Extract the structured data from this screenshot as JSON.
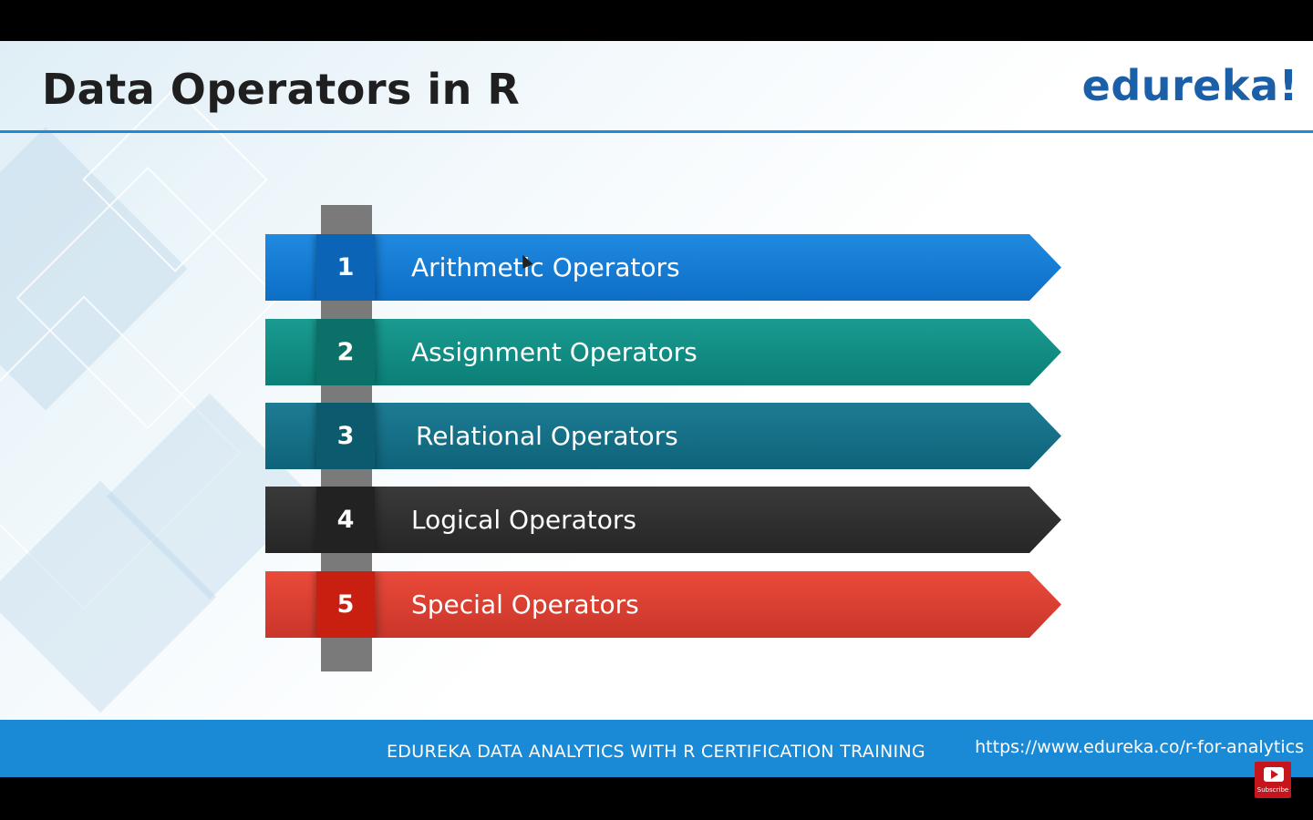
{
  "slide": {
    "title": "Data Operators in R",
    "logo": "edureka!"
  },
  "items": [
    {
      "number": "1",
      "label": "Arithmetic Operators",
      "color": "#1a82da"
    },
    {
      "number": "2",
      "label": "Assignment Operators",
      "color": "#11908a"
    },
    {
      "number": "3",
      "label": "Relational Operators",
      "color": "#146f86"
    },
    {
      "number": "4",
      "label": "Logical Operators",
      "color": "#2f2f2f"
    },
    {
      "number": "5",
      "label": "Special Operators",
      "color": "#de4133"
    }
  ],
  "footer": {
    "course": "EDUREKA DATA ANALYTICS WITH R CERTIFICATION TRAINING",
    "url": "https://www.edureka.co/r-for-analytics"
  },
  "youtube": {
    "subscribe_label": "Subscribe"
  },
  "colors": {
    "accent": "#1a8ad6",
    "logo": "#1a5fa8"
  }
}
